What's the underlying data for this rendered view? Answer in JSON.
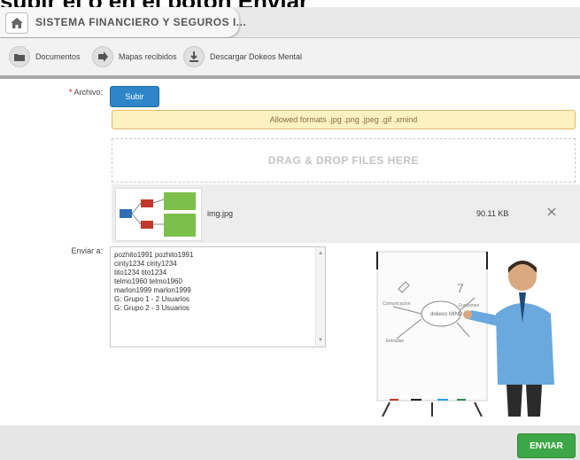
{
  "top_caption": "subir el o en el botón Enviar",
  "app": {
    "title": "SISTEMA FINANCIERO Y SEGUROS I..."
  },
  "toolbar": {
    "items": [
      {
        "label": "Documentos",
        "icon": "folder-icon"
      },
      {
        "label": "Mapas recibidos",
        "icon": "arrow-icon"
      },
      {
        "label": "Descargar Dokeos Mental",
        "icon": "download-icon"
      }
    ]
  },
  "form": {
    "archivo_label": "Archivo:",
    "required_mark": "*",
    "subir_label": "Subir",
    "formats_notice": "Allowed formats .jpg .png .jpeg .gif .xmind",
    "dropzone_text": "DRAG & DROP FILES HERE",
    "file": {
      "name": "img.jpg",
      "size": "90.11 KB"
    },
    "enviar_label": "Enviar a:",
    "recipients": [
      "pozhito1991 pozhito1991",
      "cinty1234 cinty1234",
      "tito1234 tito1234",
      "telmo1960 telmo1960",
      "marlon1999 marlon1999",
      "G: Grupo 1 - 2 Usuarios",
      "G: Grupo 2 - 3 Usuarios"
    ]
  },
  "illustration": {
    "flipchart_texts": [
      "Comunicacion",
      "Funciones",
      "dokeos MIND",
      "Entradas"
    ]
  },
  "footer": {
    "submit_label": "ENVIAR"
  },
  "colors": {
    "primary_button": "#2e86c9",
    "submit_button": "#3da646",
    "notice_bg": "#fcf1c1"
  }
}
